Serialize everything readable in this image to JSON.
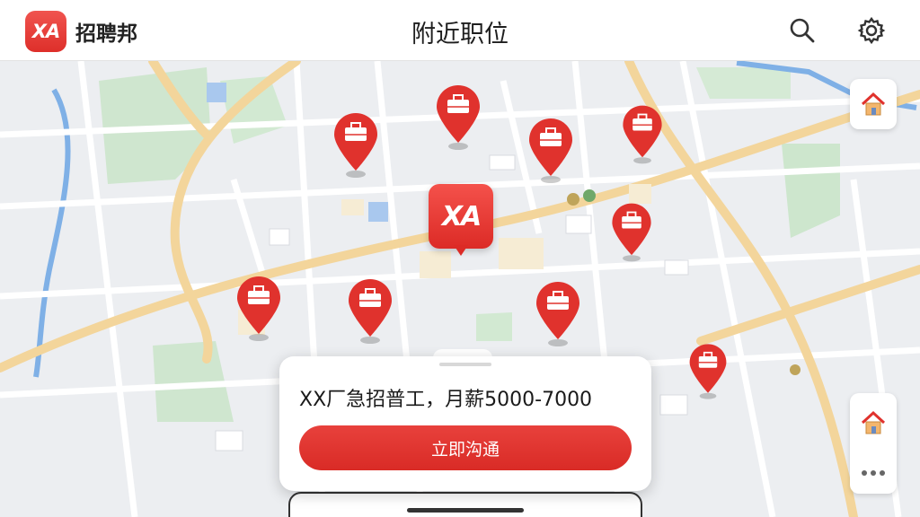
{
  "app": {
    "logo_text": "XA",
    "name": "招聘邦"
  },
  "header": {
    "title": "附近职位",
    "search_icon": "search-icon",
    "settings_icon": "gear-icon"
  },
  "map": {
    "center_marker_text": "XA",
    "job_pins": 10,
    "icons": [
      "briefcase-pin-icon",
      "home-icon",
      "more-icon"
    ]
  },
  "job_card": {
    "title": "XX厂急招普工，月薪5000-7000",
    "action_label": "立即沟通"
  },
  "colors": {
    "accent": "#e0322d",
    "map_road": "#f3d59b",
    "map_green": "#cfe8cf",
    "map_water": "#7fb0e6"
  }
}
